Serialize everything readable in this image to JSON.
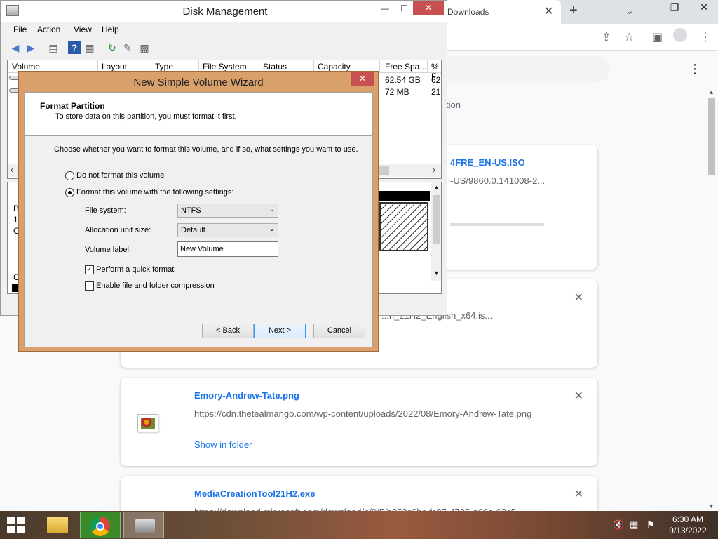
{
  "chrome": {
    "tab_title": "Downloads",
    "tab_close": "✕",
    "new_tab": "+",
    "dropdown": "⌄",
    "window_buttons": [
      "—",
      "❐",
      "✕"
    ],
    "toolbar_icons": [
      "share-icon",
      "star-icon",
      "sidebar-icon",
      "profile-icon",
      "kebab-menu-icon"
    ],
    "partial_heading": "tion",
    "downloads": [
      {
        "name": "4FRE_EN-US.ISO",
        "url": "-US/9860.0.141008-2...",
        "link": "",
        "in_progress": true,
        "progress": 0.55
      },
      {
        "name": "",
        "url": "...n_21H2_English_x64.is...",
        "link": ""
      },
      {
        "name": "Emory-Andrew-Tate.png",
        "url": "https://cdn.thetealmango.com/wp-content/uploads/2022/08/Emory-Andrew-Tate.png",
        "link": "Show in folder"
      },
      {
        "name": "MediaCreationTool21H2.exe",
        "url": "https://download.microsoft.com/download/b/0/5/b053c6bc-fc07-4785-a66a-63c5...",
        "link": ""
      }
    ]
  },
  "disk_mgmt": {
    "title": "Disk Management",
    "window_buttons": [
      "—",
      "☐",
      "✕"
    ],
    "menu": [
      "File",
      "Action",
      "View",
      "Help"
    ],
    "columns": [
      "Volume",
      "Layout",
      "Type",
      "File System",
      "Status",
      "Capacity",
      "Free Spa...",
      "% F"
    ],
    "rows": [
      {
        "free": "62.54 GB",
        "pct": "62"
      },
      {
        "free": "72 MB",
        "pct": "21"
      }
    ],
    "bottom_labels": [
      "B",
      "1.",
      "O",
      "C"
    ]
  },
  "wizard": {
    "title": "New Simple Volume Wizard",
    "close": "✕",
    "header_title": "Format Partition",
    "header_sub": "To store data on this partition, you must format it first.",
    "prompt": "Choose whether you want to format this volume, and if so, what settings you want to use.",
    "option_no_format": "Do not format this volume",
    "option_format": "Format this volume with the following settings:",
    "selected_option": "format",
    "fs_label": "File system:",
    "fs_value": "NTFS",
    "alloc_label": "Allocation unit size:",
    "alloc_value": "Default",
    "vol_label": "Volume label:",
    "vol_value": "New Volume",
    "quick_format_label": "Perform a quick format",
    "quick_format_checked": true,
    "compression_label": "Enable file and folder compression",
    "compression_checked": false,
    "back": "< Back",
    "next": "Next >",
    "cancel": "Cancel"
  },
  "taskbar": {
    "time": "6:30 AM",
    "date": "9/13/2022",
    "apps": [
      "file-explorer",
      "google-chrome",
      "disk-management"
    ],
    "tray_icons": [
      "speaker-muted-icon",
      "network-icon",
      "flag-icon"
    ]
  }
}
